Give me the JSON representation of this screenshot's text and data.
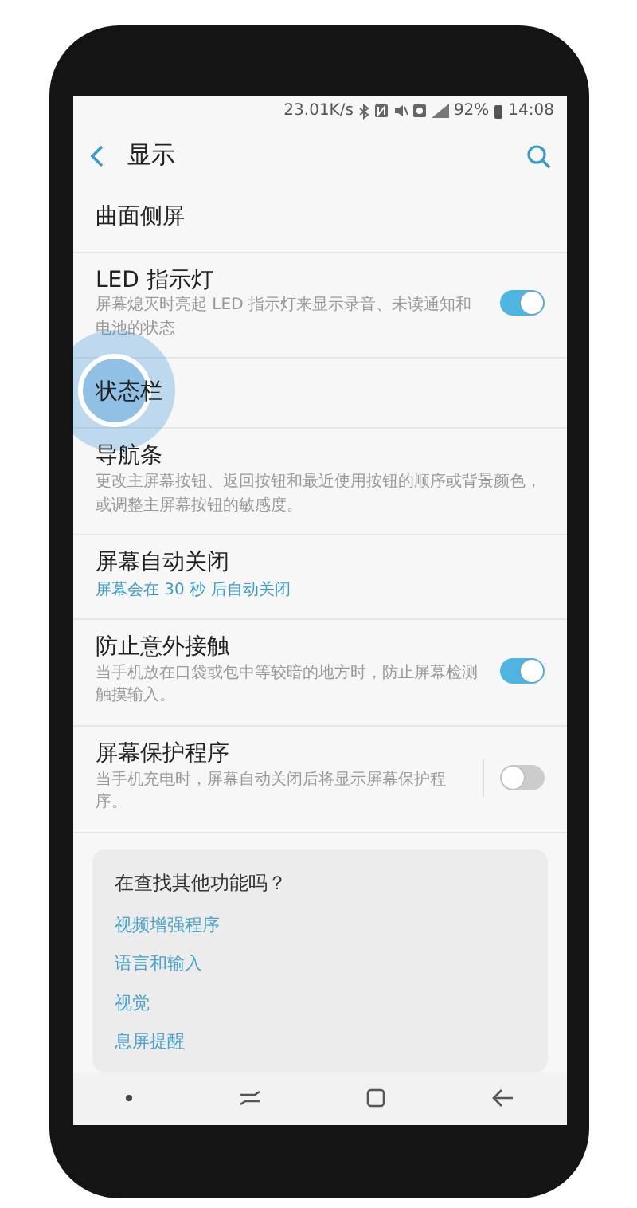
{
  "status_bar": {
    "speed": "23.01K/s",
    "battery": "92%",
    "time": "14:08"
  },
  "header": {
    "title": "显示"
  },
  "settings": [
    {
      "kind": "plain",
      "title": "曲面侧屏"
    },
    {
      "kind": "switch",
      "title": "LED 指示灯",
      "description": "屏幕熄灭时亮起 LED 指示灯来显示录音、未读通知和电池的状态",
      "on": true
    },
    {
      "kind": "plain",
      "title": "状态栏",
      "touched": true
    },
    {
      "kind": "plain",
      "title": "导航条",
      "description": "更改主屏幕按钮、返回按钮和最近使用按钮的顺序或背景颜色，或调整主屏幕按钮的敏感度。"
    },
    {
      "kind": "plain",
      "title": "屏幕自动关闭",
      "value": "屏幕会在 30 秒 后自动关闭"
    },
    {
      "kind": "switch",
      "title": "防止意外接触",
      "description": "当手机放在口袋或包中等较暗的地方时，防止屏幕检测触摸输入。",
      "on": true
    },
    {
      "kind": "split-switch",
      "title": "屏幕保护程序",
      "description": "当手机充电时，屏幕自动关闭后将显示屏幕保护程序。",
      "on": false
    }
  ],
  "suggestions": {
    "title": "在查找其他功能吗？",
    "links": [
      "视频增强程序",
      "语言和输入",
      "视觉",
      "息屏提醒"
    ]
  }
}
